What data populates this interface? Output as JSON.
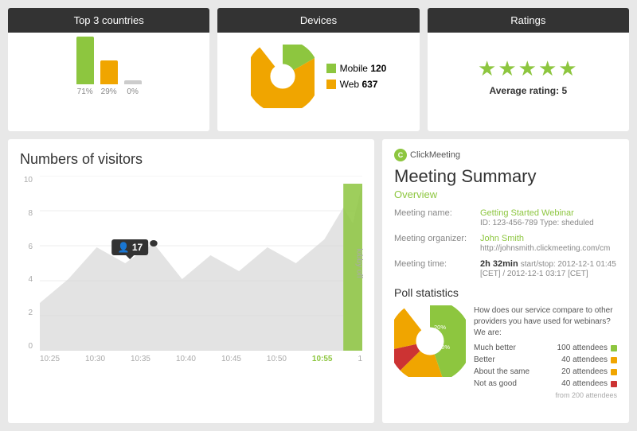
{
  "top_row": {
    "countries": {
      "header": "Top 3 countries",
      "bars": [
        {
          "height": 60,
          "color": "#8dc63f",
          "label": "71%"
        },
        {
          "height": 30,
          "color": "#f0a500",
          "label": "29%"
        },
        {
          "height": 5,
          "color": "#ccc",
          "label": "0%"
        }
      ]
    },
    "devices": {
      "header": "Devices",
      "mobile_count": "120",
      "web_count": "637",
      "mobile_label": "Mobile",
      "web_label": "Web"
    },
    "ratings": {
      "header": "Ratings",
      "stars": "★★★★★",
      "average_text": "Average rating:",
      "average_value": "5"
    }
  },
  "visitors": {
    "title": "Numbers of visitors",
    "y_labels": [
      "10",
      "8",
      "6",
      "4",
      "2",
      "0"
    ],
    "x_labels": [
      "10:25",
      "10:30",
      "10:35",
      "10:40",
      "10:45",
      "10:50",
      "10:55",
      "1"
    ],
    "active_x": "10:55",
    "tooltip_value": "17",
    "lobby_label": "lobby off"
  },
  "meeting": {
    "logo_text": "ClickMeeting",
    "title": "Meeting Summary",
    "overview": "Overview",
    "fields": [
      {
        "label": "Meeting name:",
        "value": "Getting Started Webinar",
        "sub": "ID: 123-456-789  Type: sheduled",
        "is_link": true
      },
      {
        "label": "Meeting organizer:",
        "value": "John Smith",
        "sub": "http://johnsmith.clickmeeting.com/cm",
        "is_link": true
      },
      {
        "label": "Meeting time:",
        "value": "2h 32min",
        "sub": "start/stop: 2012-12-1 01:45 [CET] / 2012-12-1 03:17 [CET]",
        "is_link": false
      }
    ],
    "poll": {
      "title": "Poll statistics",
      "question": "How does our service compare to other providers you have used for webinars? We are:",
      "items": [
        {
          "label": "Much better",
          "count": "100 attendees",
          "color": "#8dc63f"
        },
        {
          "label": "Better",
          "count": "40 attendees",
          "color": "#f0a500"
        },
        {
          "label": "About the same",
          "count": "20 attendees",
          "color": "#f0a500"
        },
        {
          "label": "Not as good",
          "count": "40 attendees",
          "color": "#cc3333"
        }
      ],
      "footer": "from 200 attendees"
    }
  }
}
